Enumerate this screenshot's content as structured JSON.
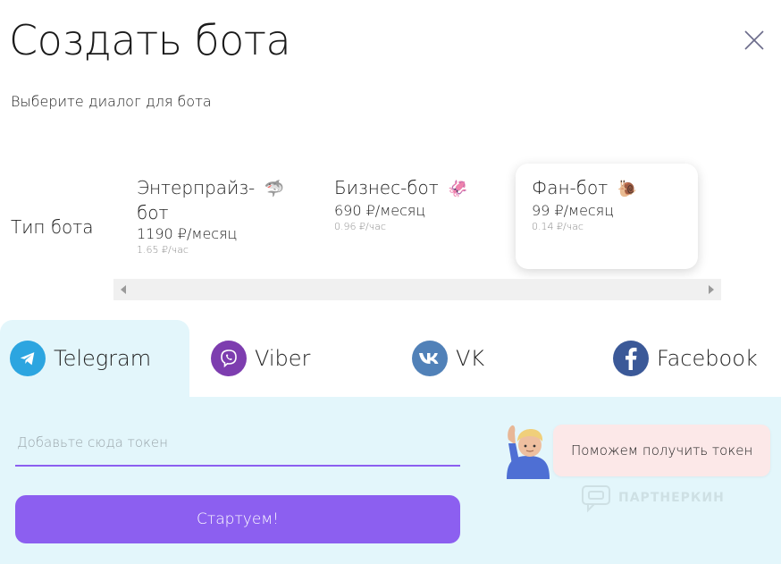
{
  "header": {
    "title": "Создать бота",
    "close_icon": "close-icon"
  },
  "subtitle": "Выберите диалог для бота",
  "bot_type": {
    "label": "Тип бота",
    "cards": [
      {
        "name_line1": "Энтерпрайз-",
        "name_line2": "бот",
        "emoji": "🦈",
        "price": "1190 ₽/месяц",
        "hourly": "1.65 ₽/час",
        "selected": false
      },
      {
        "name_line1": "Бизнес-бот",
        "name_line2": "",
        "emoji": "🦑",
        "price": "690 ₽/месяц",
        "hourly": "0.96 ₽/час",
        "selected": false
      },
      {
        "name_line1": "Фан-бот",
        "name_line2": "",
        "emoji": "🐌",
        "price": "99 ₽/месяц",
        "hourly": "0.14 ₽/час",
        "selected": true
      }
    ]
  },
  "messengers": {
    "active": "Telegram",
    "tabs": [
      {
        "label": "Telegram",
        "icon": "telegram-icon",
        "color": "#2ca5e0"
      },
      {
        "label": "Viber",
        "icon": "viber-icon",
        "color": "#7d3daf"
      },
      {
        "label": "VK",
        "icon": "vk-icon",
        "color": "#5181b8"
      },
      {
        "label": "Facebook",
        "icon": "facebook-icon",
        "color": "#3b5998"
      }
    ]
  },
  "form": {
    "token_placeholder": "Добавьте сюда токен",
    "token_value": "",
    "start_label": "Стартуем!",
    "help_label": "Поможем получить токен"
  },
  "watermark": "ПАРТНЕРКИН",
  "colors": {
    "accent": "#8c5ff0",
    "panel_bg": "#e3f6fb",
    "help_bg": "#fce8e8"
  }
}
